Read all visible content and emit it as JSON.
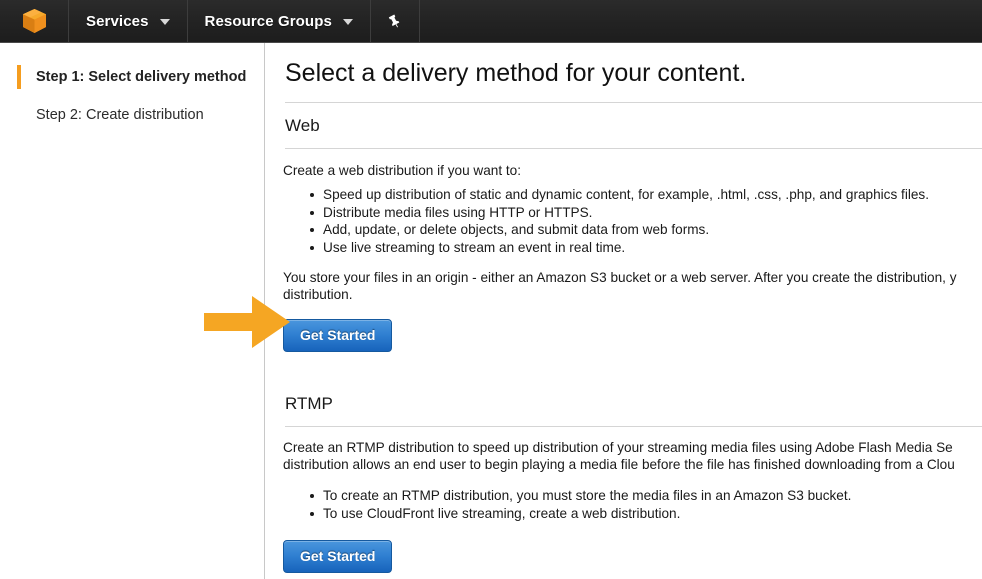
{
  "navbar": {
    "logo_icon": "aws-cube-logo",
    "items": [
      {
        "label": "Services",
        "caret_icon": "chevron-down-icon"
      },
      {
        "label": "Resource Groups",
        "caret_icon": "chevron-down-icon"
      }
    ],
    "pin_icon": "pushpin-icon",
    "background": "#232323"
  },
  "sidebar": {
    "steps": [
      {
        "label": "Step 1: Select delivery method",
        "active": true
      },
      {
        "label": "Step 2: Create distribution",
        "active": false
      }
    ],
    "active_marker_color": "#f59d1f"
  },
  "main": {
    "title": "Select a delivery method for your content.",
    "web": {
      "heading": "Web",
      "intro": "Create a web distribution if you want to:",
      "bullets": [
        "Speed up distribution of static and dynamic content, for example, .html, .css, .php, and graphics files.",
        "Distribute media files using HTTP or HTTPS.",
        "Add, update, or delete objects, and submit data from web forms.",
        "Use live streaming to stream an event in real time."
      ],
      "note": "You store your files in an origin - either an Amazon S3 bucket or a web server. After you create the distribution, y\ndistribution.",
      "button_label": "Get Started"
    },
    "rtmp": {
      "heading": "RTMP",
      "intro": "Create an RTMP distribution to speed up distribution of your streaming media files using Adobe Flash Media Se\ndistribution allows an end user to begin playing a media file before the file has finished downloading from a Clou",
      "bullets": [
        "To create an RTMP distribution, you must store the media files in an Amazon S3 bucket.",
        "To use CloudFront live streaming, create a web distribution."
      ],
      "button_label": "Get Started"
    }
  },
  "annotation": {
    "arrow_icon": "right-arrow-annotation",
    "color": "#f5a623",
    "points_at": "Get Started"
  }
}
